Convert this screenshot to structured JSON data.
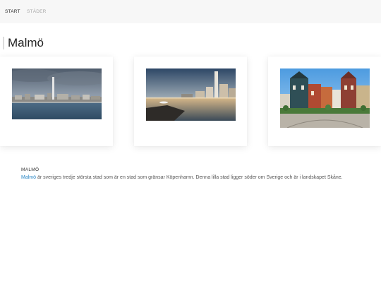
{
  "nav": {
    "items": [
      {
        "label": "START"
      },
      {
        "label": "STÄDER"
      }
    ]
  },
  "page": {
    "title": "Malmö"
  },
  "gallery": {
    "images": [
      {
        "description": "Panorama of Malmö skyline with Turning Torso"
      },
      {
        "description": "Turning Torso at sunset by the waterfront"
      },
      {
        "description": "Colorful historic buildings on a Malmö square"
      }
    ]
  },
  "info": {
    "heading": "MALMÖ",
    "link_text": "Malmö",
    "body": " är sveriges tredje största stad som är en stad som gränsar Köpenhamn. Denna lilla stad ligger söder om Sverige och är i landskapet Skåne."
  },
  "colors": {
    "nav_background": "#f7f7f7",
    "link": "#2a87c5"
  }
}
